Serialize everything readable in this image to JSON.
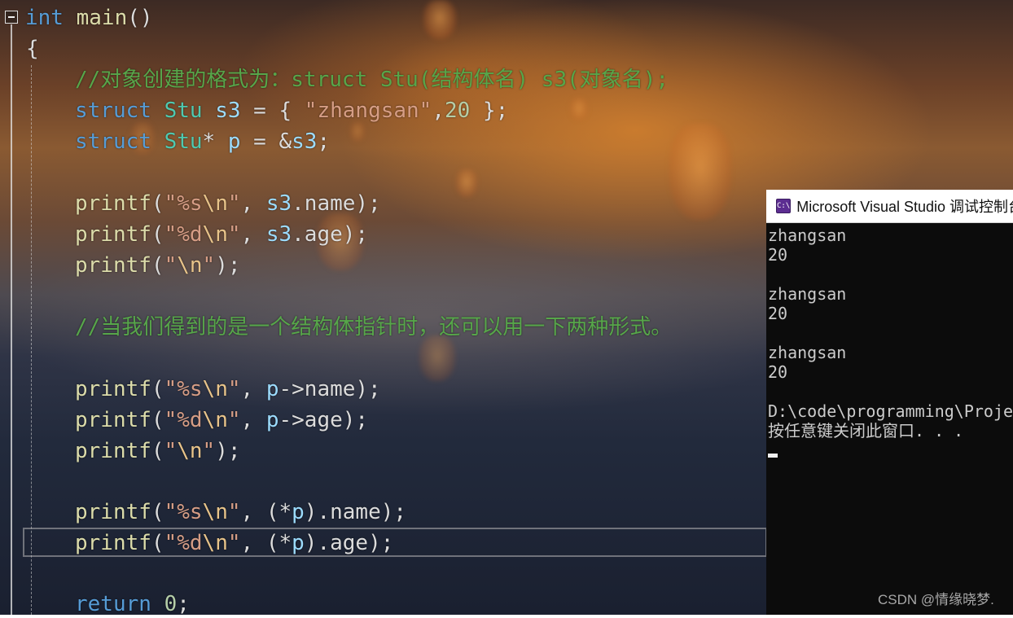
{
  "editor": {
    "lines": [
      {
        "tokens": [
          {
            "t": "int",
            "c": "kw"
          },
          {
            "t": " ",
            "c": "pl"
          },
          {
            "t": "main",
            "c": "fn"
          },
          {
            "t": "()",
            "c": "pl"
          }
        ]
      },
      {
        "tokens": [
          {
            "t": "{",
            "c": "pl"
          }
        ]
      },
      {
        "tokens": [
          {
            "t": "//对象创建的格式为：struct Stu(结构体名) s3(对象名);",
            "c": "cm"
          }
        ]
      },
      {
        "tokens": [
          {
            "t": "struct",
            "c": "kw"
          },
          {
            "t": " ",
            "c": "pl"
          },
          {
            "t": "Stu",
            "c": "ty"
          },
          {
            "t": " ",
            "c": "pl"
          },
          {
            "t": "s3",
            "c": "var"
          },
          {
            "t": " = { ",
            "c": "pl"
          },
          {
            "t": "\"zhangsan\"",
            "c": "str"
          },
          {
            "t": ",",
            "c": "pl"
          },
          {
            "t": "20",
            "c": "num"
          },
          {
            "t": " };",
            "c": "pl"
          }
        ]
      },
      {
        "tokens": [
          {
            "t": "struct",
            "c": "kw"
          },
          {
            "t": " ",
            "c": "pl"
          },
          {
            "t": "Stu",
            "c": "ty"
          },
          {
            "t": "* ",
            "c": "pl"
          },
          {
            "t": "p",
            "c": "var"
          },
          {
            "t": " = &",
            "c": "pl"
          },
          {
            "t": "s3",
            "c": "var"
          },
          {
            "t": ";",
            "c": "pl"
          }
        ]
      },
      {
        "tokens": []
      },
      {
        "tokens": [
          {
            "t": "printf",
            "c": "fn"
          },
          {
            "t": "(",
            "c": "pl"
          },
          {
            "t": "\"%s",
            "c": "str"
          },
          {
            "t": "\\n",
            "c": "esc"
          },
          {
            "t": "\"",
            "c": "str"
          },
          {
            "t": ", ",
            "c": "pl"
          },
          {
            "t": "s3",
            "c": "var"
          },
          {
            "t": ".name);",
            "c": "pl"
          }
        ]
      },
      {
        "tokens": [
          {
            "t": "printf",
            "c": "fn"
          },
          {
            "t": "(",
            "c": "pl"
          },
          {
            "t": "\"%d",
            "c": "str"
          },
          {
            "t": "\\n",
            "c": "esc"
          },
          {
            "t": "\"",
            "c": "str"
          },
          {
            "t": ", ",
            "c": "pl"
          },
          {
            "t": "s3",
            "c": "var"
          },
          {
            "t": ".age);",
            "c": "pl"
          }
        ]
      },
      {
        "tokens": [
          {
            "t": "printf",
            "c": "fn"
          },
          {
            "t": "(",
            "c": "pl"
          },
          {
            "t": "\"",
            "c": "str"
          },
          {
            "t": "\\n",
            "c": "esc"
          },
          {
            "t": "\"",
            "c": "str"
          },
          {
            "t": ");",
            "c": "pl"
          }
        ]
      },
      {
        "tokens": []
      },
      {
        "tokens": [
          {
            "t": "//当我们得到的是一个结构体指针时，还可以用一下两种形式。",
            "c": "cm"
          }
        ]
      },
      {
        "tokens": []
      },
      {
        "tokens": [
          {
            "t": "printf",
            "c": "fn"
          },
          {
            "t": "(",
            "c": "pl"
          },
          {
            "t": "\"%s",
            "c": "str"
          },
          {
            "t": "\\n",
            "c": "esc"
          },
          {
            "t": "\"",
            "c": "str"
          },
          {
            "t": ", ",
            "c": "pl"
          },
          {
            "t": "p",
            "c": "var"
          },
          {
            "t": "->name);",
            "c": "pl"
          }
        ]
      },
      {
        "tokens": [
          {
            "t": "printf",
            "c": "fn"
          },
          {
            "t": "(",
            "c": "pl"
          },
          {
            "t": "\"%d",
            "c": "str"
          },
          {
            "t": "\\n",
            "c": "esc"
          },
          {
            "t": "\"",
            "c": "str"
          },
          {
            "t": ", ",
            "c": "pl"
          },
          {
            "t": "p",
            "c": "var"
          },
          {
            "t": "->age);",
            "c": "pl"
          }
        ]
      },
      {
        "tokens": [
          {
            "t": "printf",
            "c": "fn"
          },
          {
            "t": "(",
            "c": "pl"
          },
          {
            "t": "\"",
            "c": "str"
          },
          {
            "t": "\\n",
            "c": "esc"
          },
          {
            "t": "\"",
            "c": "str"
          },
          {
            "t": ");",
            "c": "pl"
          }
        ]
      },
      {
        "tokens": []
      },
      {
        "tokens": [
          {
            "t": "printf",
            "c": "fn"
          },
          {
            "t": "(",
            "c": "pl"
          },
          {
            "t": "\"%s",
            "c": "str"
          },
          {
            "t": "\\n",
            "c": "esc"
          },
          {
            "t": "\"",
            "c": "str"
          },
          {
            "t": ", (*",
            "c": "pl"
          },
          {
            "t": "p",
            "c": "var"
          },
          {
            "t": ").name);",
            "c": "pl"
          }
        ]
      },
      {
        "tokens": [
          {
            "t": "printf",
            "c": "fn"
          },
          {
            "t": "(",
            "c": "pl"
          },
          {
            "t": "\"%d",
            "c": "str"
          },
          {
            "t": "\\n",
            "c": "esc"
          },
          {
            "t": "\"",
            "c": "str"
          },
          {
            "t": ", (*",
            "c": "pl"
          },
          {
            "t": "p",
            "c": "var"
          },
          {
            "t": ").age);",
            "c": "pl"
          }
        ]
      },
      {
        "tokens": []
      },
      {
        "tokens": [
          {
            "t": "return",
            "c": "kw"
          },
          {
            "t": " ",
            "c": "pl"
          },
          {
            "t": "0",
            "c": "num"
          },
          {
            "t": ";",
            "c": "pl"
          }
        ]
      }
    ]
  },
  "console": {
    "title": "Microsoft Visual Studio 调试控制台",
    "icon_label": "C:\\",
    "output": [
      "zhangsan",
      "20",
      "",
      "zhangsan",
      "20",
      "",
      "zhangsan",
      "20",
      "",
      "D:\\code\\programming\\Project",
      "按任意键关闭此窗口. . ."
    ]
  },
  "watermark": "CSDN @情缘晓梦.",
  "colors": {
    "keyword": "#569cd6",
    "type": "#4ec9b0",
    "function": "#dcdcaa",
    "string": "#d69d85",
    "number": "#b5cea8",
    "variable": "#9cdcfe",
    "comment": "#57a64a",
    "console_bg": "#0c0c0c"
  },
  "icons": [
    "collapse-icon",
    "visual-studio-console-icon"
  ]
}
